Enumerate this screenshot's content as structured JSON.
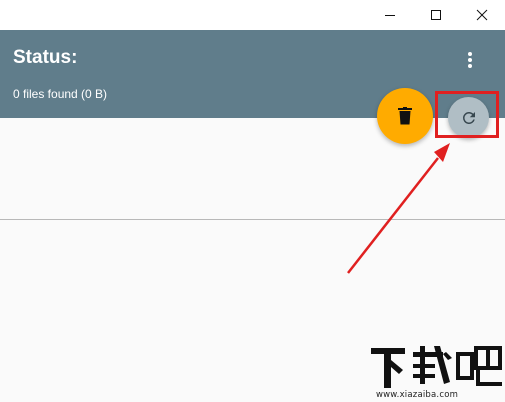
{
  "window_controls": {
    "minimize_icon": "minimize-icon",
    "maximize_icon": "maximize-icon",
    "close_icon": "close-icon"
  },
  "header": {
    "title": "Status:",
    "detail": "0 files found (0 B)",
    "background_color": "#607d8b",
    "menu_icon": "more-vert-icon"
  },
  "actions": {
    "delete_icon": "trash-icon",
    "delete_color": "#ffab00",
    "refresh_icon": "refresh-icon",
    "refresh_color": "#b0bec5"
  },
  "annotation": {
    "highlight_color": "#e02020"
  },
  "watermark": {
    "text": "下载吧",
    "url": "www.xiazaiba.com"
  }
}
